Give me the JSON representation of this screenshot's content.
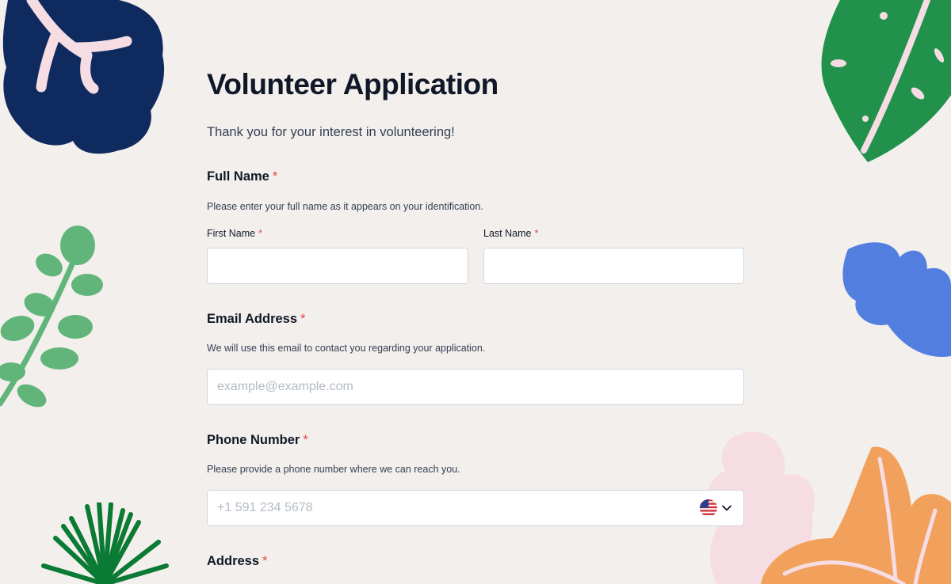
{
  "form": {
    "title": "Volunteer Application",
    "subtitle": "Thank you for your interest in volunteering!",
    "required_marker": "*",
    "sections": {
      "full_name": {
        "label": "Full Name",
        "help": "Please enter your full name as it appears on your identification.",
        "first_name_label": "First Name",
        "first_name_value": "",
        "last_name_label": "Last Name",
        "last_name_value": ""
      },
      "email": {
        "label": "Email Address",
        "help": "We will use this email to contact you regarding your application.",
        "placeholder": "example@example.com",
        "value": ""
      },
      "phone": {
        "label": "Phone Number",
        "help": "Please provide a phone number where we can reach you.",
        "placeholder": "+1 591 234 5678",
        "value": "",
        "country_icon": "us-flag-icon",
        "dropdown_icon": "chevron-down-icon"
      },
      "address": {
        "label": "Address"
      }
    }
  },
  "colors": {
    "background": "#f3efec",
    "required": "#e5484d",
    "leaf_navy": "#0f2a5f",
    "leaf_pink": "#f5dde3",
    "leaf_green": "#22914c",
    "leaf_sage": "#62b57a",
    "leaf_blue": "#527ee0",
    "leaf_orange": "#f2a15c",
    "leaf_dark_green": "#0a7a34"
  }
}
